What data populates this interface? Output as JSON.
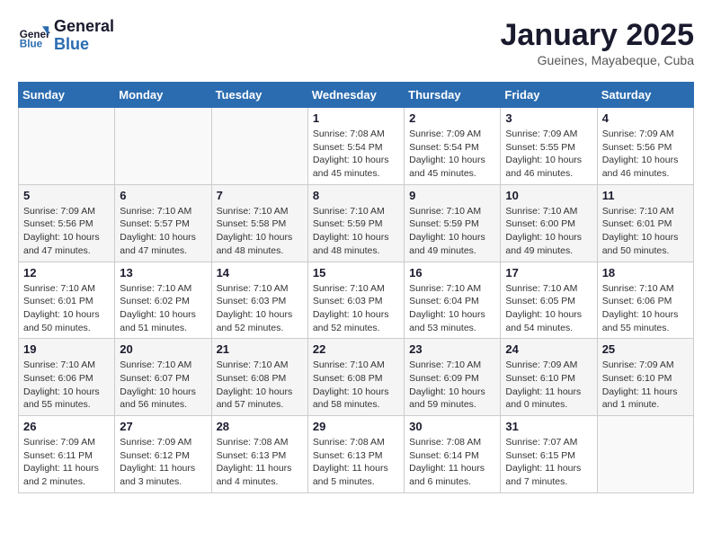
{
  "header": {
    "logo_line1": "General",
    "logo_line2": "Blue",
    "month": "January 2025",
    "location": "Gueines, Mayabeque, Cuba"
  },
  "days_of_week": [
    "Sunday",
    "Monday",
    "Tuesday",
    "Wednesday",
    "Thursday",
    "Friday",
    "Saturday"
  ],
  "weeks": [
    [
      {
        "day": "",
        "info": ""
      },
      {
        "day": "",
        "info": ""
      },
      {
        "day": "",
        "info": ""
      },
      {
        "day": "1",
        "info": "Sunrise: 7:08 AM\nSunset: 5:54 PM\nDaylight: 10 hours and 45 minutes."
      },
      {
        "day": "2",
        "info": "Sunrise: 7:09 AM\nSunset: 5:54 PM\nDaylight: 10 hours and 45 minutes."
      },
      {
        "day": "3",
        "info": "Sunrise: 7:09 AM\nSunset: 5:55 PM\nDaylight: 10 hours and 46 minutes."
      },
      {
        "day": "4",
        "info": "Sunrise: 7:09 AM\nSunset: 5:56 PM\nDaylight: 10 hours and 46 minutes."
      }
    ],
    [
      {
        "day": "5",
        "info": "Sunrise: 7:09 AM\nSunset: 5:56 PM\nDaylight: 10 hours and 47 minutes."
      },
      {
        "day": "6",
        "info": "Sunrise: 7:10 AM\nSunset: 5:57 PM\nDaylight: 10 hours and 47 minutes."
      },
      {
        "day": "7",
        "info": "Sunrise: 7:10 AM\nSunset: 5:58 PM\nDaylight: 10 hours and 48 minutes."
      },
      {
        "day": "8",
        "info": "Sunrise: 7:10 AM\nSunset: 5:59 PM\nDaylight: 10 hours and 48 minutes."
      },
      {
        "day": "9",
        "info": "Sunrise: 7:10 AM\nSunset: 5:59 PM\nDaylight: 10 hours and 49 minutes."
      },
      {
        "day": "10",
        "info": "Sunrise: 7:10 AM\nSunset: 6:00 PM\nDaylight: 10 hours and 49 minutes."
      },
      {
        "day": "11",
        "info": "Sunrise: 7:10 AM\nSunset: 6:01 PM\nDaylight: 10 hours and 50 minutes."
      }
    ],
    [
      {
        "day": "12",
        "info": "Sunrise: 7:10 AM\nSunset: 6:01 PM\nDaylight: 10 hours and 50 minutes."
      },
      {
        "day": "13",
        "info": "Sunrise: 7:10 AM\nSunset: 6:02 PM\nDaylight: 10 hours and 51 minutes."
      },
      {
        "day": "14",
        "info": "Sunrise: 7:10 AM\nSunset: 6:03 PM\nDaylight: 10 hours and 52 minutes."
      },
      {
        "day": "15",
        "info": "Sunrise: 7:10 AM\nSunset: 6:03 PM\nDaylight: 10 hours and 52 minutes."
      },
      {
        "day": "16",
        "info": "Sunrise: 7:10 AM\nSunset: 6:04 PM\nDaylight: 10 hours and 53 minutes."
      },
      {
        "day": "17",
        "info": "Sunrise: 7:10 AM\nSunset: 6:05 PM\nDaylight: 10 hours and 54 minutes."
      },
      {
        "day": "18",
        "info": "Sunrise: 7:10 AM\nSunset: 6:06 PM\nDaylight: 10 hours and 55 minutes."
      }
    ],
    [
      {
        "day": "19",
        "info": "Sunrise: 7:10 AM\nSunset: 6:06 PM\nDaylight: 10 hours and 55 minutes."
      },
      {
        "day": "20",
        "info": "Sunrise: 7:10 AM\nSunset: 6:07 PM\nDaylight: 10 hours and 56 minutes."
      },
      {
        "day": "21",
        "info": "Sunrise: 7:10 AM\nSunset: 6:08 PM\nDaylight: 10 hours and 57 minutes."
      },
      {
        "day": "22",
        "info": "Sunrise: 7:10 AM\nSunset: 6:08 PM\nDaylight: 10 hours and 58 minutes."
      },
      {
        "day": "23",
        "info": "Sunrise: 7:10 AM\nSunset: 6:09 PM\nDaylight: 10 hours and 59 minutes."
      },
      {
        "day": "24",
        "info": "Sunrise: 7:09 AM\nSunset: 6:10 PM\nDaylight: 11 hours and 0 minutes."
      },
      {
        "day": "25",
        "info": "Sunrise: 7:09 AM\nSunset: 6:10 PM\nDaylight: 11 hours and 1 minute."
      }
    ],
    [
      {
        "day": "26",
        "info": "Sunrise: 7:09 AM\nSunset: 6:11 PM\nDaylight: 11 hours and 2 minutes."
      },
      {
        "day": "27",
        "info": "Sunrise: 7:09 AM\nSunset: 6:12 PM\nDaylight: 11 hours and 3 minutes."
      },
      {
        "day": "28",
        "info": "Sunrise: 7:08 AM\nSunset: 6:13 PM\nDaylight: 11 hours and 4 minutes."
      },
      {
        "day": "29",
        "info": "Sunrise: 7:08 AM\nSunset: 6:13 PM\nDaylight: 11 hours and 5 minutes."
      },
      {
        "day": "30",
        "info": "Sunrise: 7:08 AM\nSunset: 6:14 PM\nDaylight: 11 hours and 6 minutes."
      },
      {
        "day": "31",
        "info": "Sunrise: 7:07 AM\nSunset: 6:15 PM\nDaylight: 11 hours and 7 minutes."
      },
      {
        "day": "",
        "info": ""
      }
    ]
  ]
}
